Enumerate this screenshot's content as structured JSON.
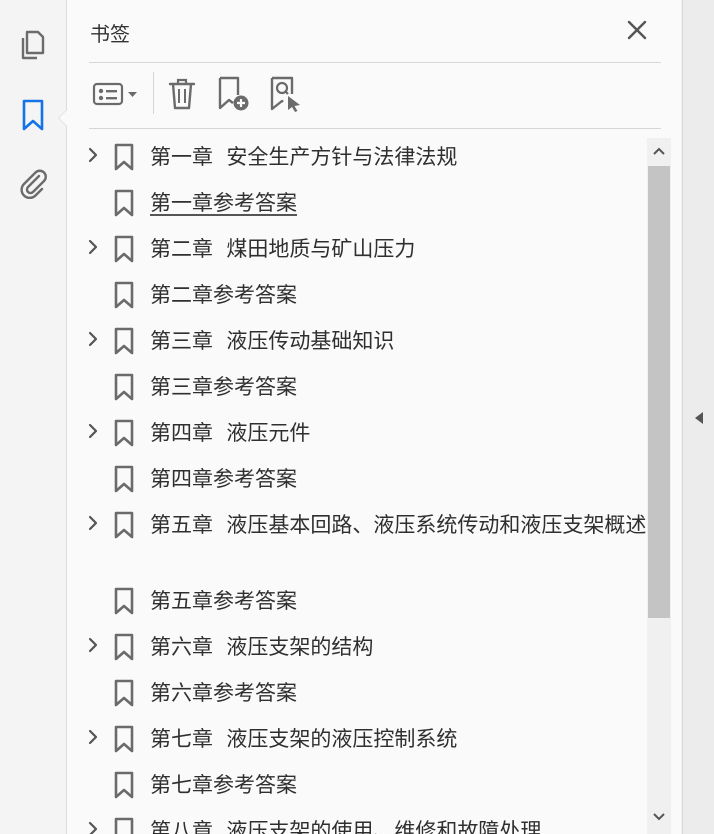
{
  "panel": {
    "title": "书签"
  },
  "colors": {
    "accent": "#1473e6",
    "icon": "#6b6b6b",
    "text": "#2f2f2f"
  },
  "rail": {
    "items": [
      {
        "icon": "pages-icon",
        "active": false
      },
      {
        "icon": "bookmark-icon",
        "active": true
      },
      {
        "icon": "attachment-icon",
        "active": false
      }
    ]
  },
  "toolbar": {
    "icons": [
      "options-menu-icon",
      "delete-icon",
      "add-bookmark-icon",
      "find-bookmark-icon"
    ]
  },
  "bookmarks": [
    {
      "label": "第一章  安全生产方针与法律法规",
      "expandable": true
    },
    {
      "label": "第一章参考答案",
      "expandable": false,
      "underlined": true
    },
    {
      "label": "第二章  煤田地质与矿山压力",
      "expandable": true
    },
    {
      "label": "第二章参考答案",
      "expandable": false
    },
    {
      "label": "第三章  液压传动基础知识",
      "expandable": true
    },
    {
      "label": "第三章参考答案",
      "expandable": false
    },
    {
      "label": "第四章  液压元件",
      "expandable": true
    },
    {
      "label": "第四章参考答案",
      "expandable": false
    },
    {
      "label": "第五章  液压基本回路、液压系统传动和液压支架概述",
      "expandable": true
    },
    {
      "label": "第五章参考答案",
      "expandable": false
    },
    {
      "label": "第六章  液压支架的结构",
      "expandable": true
    },
    {
      "label": "第六章参考答案",
      "expandable": false
    },
    {
      "label": "第七章  液压支架的液压控制系统",
      "expandable": true
    },
    {
      "label": "第七章参考答案",
      "expandable": false
    },
    {
      "label": "第八章  液压支架的使用、维修和故障处理",
      "expandable": true
    }
  ]
}
